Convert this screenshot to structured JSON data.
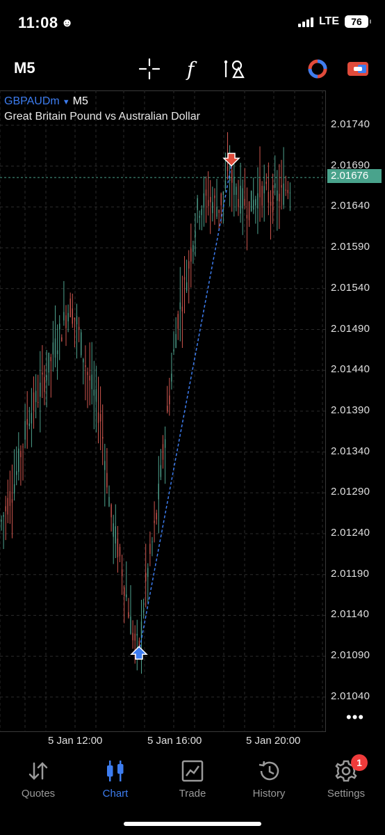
{
  "status_bar": {
    "time": "11:08",
    "network": "LTE",
    "battery": "76"
  },
  "toolbar": {
    "timeframe": "M5",
    "icons": [
      "crosshair-icon",
      "indicator-function-icon",
      "objects-icon",
      "account-icon",
      "trade-toggle-icon"
    ]
  },
  "chart": {
    "symbol": "GBPAUDm",
    "timeframe": "M5",
    "description": "Great Britain Pound vs Australian Dollar",
    "current_price": "2.01676",
    "price_axis": [
      "2.01740",
      "2.01690",
      "2.01640",
      "2.01590",
      "2.01540",
      "2.01490",
      "2.01440",
      "2.01390",
      "2.01340",
      "2.01290",
      "2.01240",
      "2.01190",
      "2.01140",
      "2.01090",
      "2.01040"
    ],
    "time_axis": [
      "5 Jan 12:00",
      "5 Jan 16:00",
      "5 Jan 20:00"
    ],
    "more_label": "•••",
    "colors": {
      "bull": "#4fa38f",
      "bear": "#d0574f",
      "trade_line": "#3d7df0",
      "price_line": "#49a38c"
    }
  },
  "tabs": [
    {
      "label": "Quotes",
      "icon": "quotes-arrows-icon",
      "active": false
    },
    {
      "label": "Chart",
      "icon": "candlestick-icon",
      "active": true
    },
    {
      "label": "Trade",
      "icon": "trade-chart-icon",
      "active": false
    },
    {
      "label": "History",
      "icon": "history-clock-icon",
      "active": false
    },
    {
      "label": "Settings",
      "icon": "gear-icon",
      "active": false,
      "badge": "1"
    }
  ]
}
